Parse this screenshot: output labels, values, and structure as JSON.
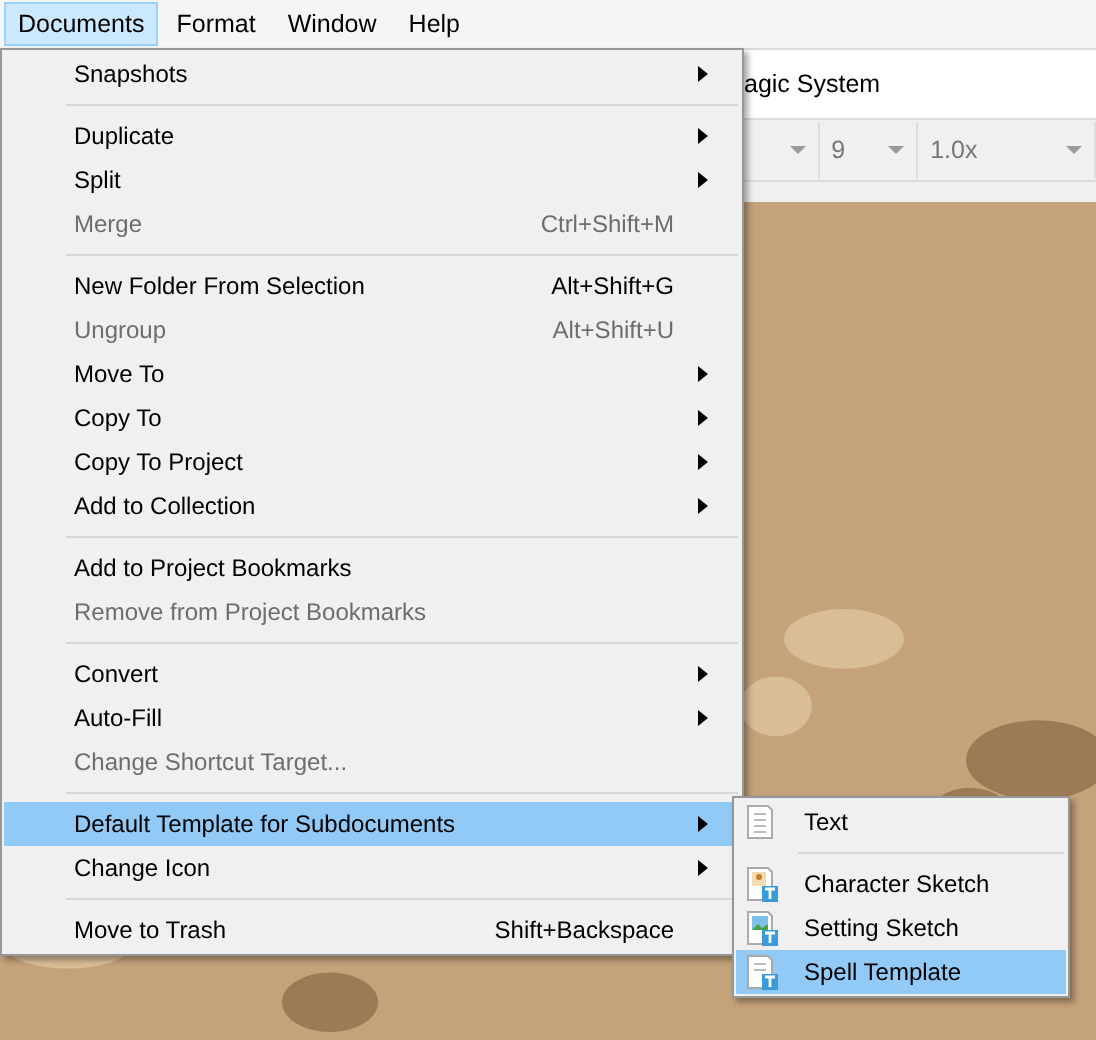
{
  "menubar": [
    {
      "label": "Documents",
      "selected": true
    },
    {
      "label": "Format",
      "selected": false
    },
    {
      "label": "Window",
      "selected": false
    },
    {
      "label": "Help",
      "selected": false
    }
  ],
  "title_field": {
    "value": "agic System"
  },
  "toolbar": [
    {
      "kind": "caret"
    },
    {
      "kind": "select",
      "value": "9"
    },
    {
      "kind": "select",
      "value": "1.0x"
    }
  ],
  "menu": [
    {
      "kind": "item",
      "label": "Snapshots",
      "submenu": true,
      "disabled": false,
      "selected": false
    },
    {
      "kind": "separator"
    },
    {
      "kind": "item",
      "label": "Duplicate",
      "submenu": true,
      "disabled": false,
      "selected": false
    },
    {
      "kind": "item",
      "label": "Split",
      "submenu": true,
      "disabled": false,
      "selected": false
    },
    {
      "kind": "item",
      "label": "Merge",
      "shortcut": "Ctrl+Shift+M",
      "disabled": true,
      "selected": false
    },
    {
      "kind": "separator"
    },
    {
      "kind": "item",
      "label": "New Folder From Selection",
      "shortcut": "Alt+Shift+G",
      "disabled": false,
      "selected": false
    },
    {
      "kind": "item",
      "label": "Ungroup",
      "shortcut": "Alt+Shift+U",
      "disabled": true,
      "selected": false
    },
    {
      "kind": "item",
      "label": "Move To",
      "submenu": true,
      "disabled": false,
      "selected": false
    },
    {
      "kind": "item",
      "label": "Copy To",
      "submenu": true,
      "disabled": false,
      "selected": false
    },
    {
      "kind": "item",
      "label": "Copy To Project",
      "submenu": true,
      "disabled": false,
      "selected": false
    },
    {
      "kind": "item",
      "label": "Add to Collection",
      "submenu": true,
      "disabled": false,
      "selected": false
    },
    {
      "kind": "separator"
    },
    {
      "kind": "item",
      "label": "Add to Project Bookmarks",
      "disabled": false,
      "selected": false
    },
    {
      "kind": "item",
      "label": "Remove from Project Bookmarks",
      "disabled": true,
      "selected": false
    },
    {
      "kind": "separator"
    },
    {
      "kind": "item",
      "label": "Convert",
      "submenu": true,
      "disabled": false,
      "selected": false
    },
    {
      "kind": "item",
      "label": "Auto-Fill",
      "submenu": true,
      "disabled": false,
      "selected": false
    },
    {
      "kind": "item",
      "label": "Change Shortcut Target...",
      "disabled": true,
      "selected": false
    },
    {
      "kind": "separator"
    },
    {
      "kind": "item",
      "label": "Default Template for Subdocuments",
      "submenu": true,
      "disabled": false,
      "selected": true
    },
    {
      "kind": "item",
      "label": "Change Icon",
      "submenu": true,
      "disabled": false,
      "selected": false
    },
    {
      "kind": "separator"
    },
    {
      "kind": "item",
      "label": "Move to Trash",
      "shortcut": "Shift+Backspace",
      "disabled": false,
      "selected": false
    }
  ],
  "submenu": [
    {
      "kind": "text",
      "label": "Text",
      "selected": false
    },
    {
      "kind": "separator"
    },
    {
      "kind": "character",
      "label": "Character Sketch",
      "selected": false
    },
    {
      "kind": "setting",
      "label": "Setting Sketch",
      "selected": false
    },
    {
      "kind": "template",
      "label": "Spell Template",
      "selected": true
    }
  ]
}
